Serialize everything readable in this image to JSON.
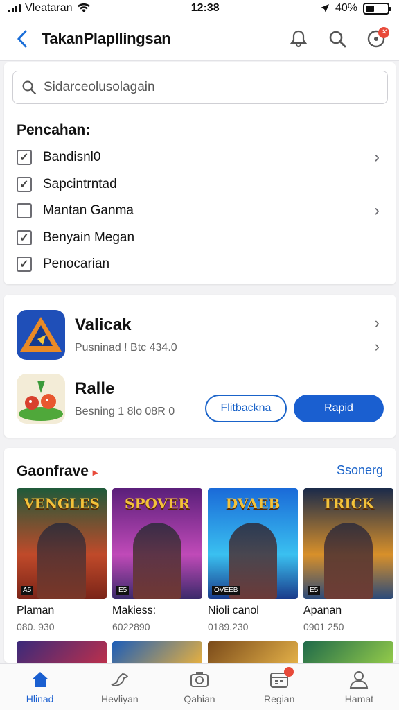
{
  "status": {
    "carrier": "Vleataran",
    "time": "12:38",
    "battery": "40%",
    "battery_level": 0.4
  },
  "header": {
    "title": "TakanPlapllingsan"
  },
  "search": {
    "placeholder": "Sidarceolusolagain"
  },
  "filters": {
    "title": "Pencahan:",
    "items": [
      {
        "label": "Bandisnl0",
        "checked": true,
        "chevron": true
      },
      {
        "label": "Sapcintrntad",
        "checked": true,
        "chevron": false
      },
      {
        "label": "Mantan Ganma",
        "checked": false,
        "chevron": true
      },
      {
        "label": "Benyain Megan",
        "checked": true,
        "chevron": false
      },
      {
        "label": "Penocarian",
        "checked": true,
        "chevron": false
      }
    ]
  },
  "apps": [
    {
      "name": "Valicak",
      "sub": "Pusninad ! Btc 434.0"
    },
    {
      "name": "Ralle",
      "sub": "Besning 1 8lo 08R 0"
    }
  ],
  "buttons": {
    "outline": "Flitbackna",
    "primary": "Rapid"
  },
  "games_section": {
    "title": "Gaonfrave",
    "see_all": "Ssonerg",
    "games": [
      {
        "name": "Plaman",
        "sub": "080. 930",
        "logo": "VENGLES",
        "tag": "A5"
      },
      {
        "name": "Makiess:",
        "sub": "6022890",
        "logo": "SPOVER",
        "tag": "E5"
      },
      {
        "name": "Nioli canol",
        "sub": "0189.230",
        "logo": "DVAEB",
        "tag": "OVEEB"
      },
      {
        "name": "Apanan",
        "sub": "0901 250",
        "logo": "TRICK",
        "tag": "E5"
      }
    ]
  },
  "tabs": [
    {
      "label": "Hlinad",
      "icon": "home-icon",
      "active": true
    },
    {
      "label": "Hevliyan",
      "icon": "bird-icon",
      "active": false
    },
    {
      "label": "Qahian",
      "icon": "camera-icon",
      "active": false
    },
    {
      "label": "Regian",
      "icon": "calendar-icon",
      "active": false
    },
    {
      "label": "Hamat",
      "icon": "profile-icon",
      "active": false
    }
  ],
  "colors": {
    "accent": "#1a5fd0",
    "badge": "#e84a3a"
  }
}
